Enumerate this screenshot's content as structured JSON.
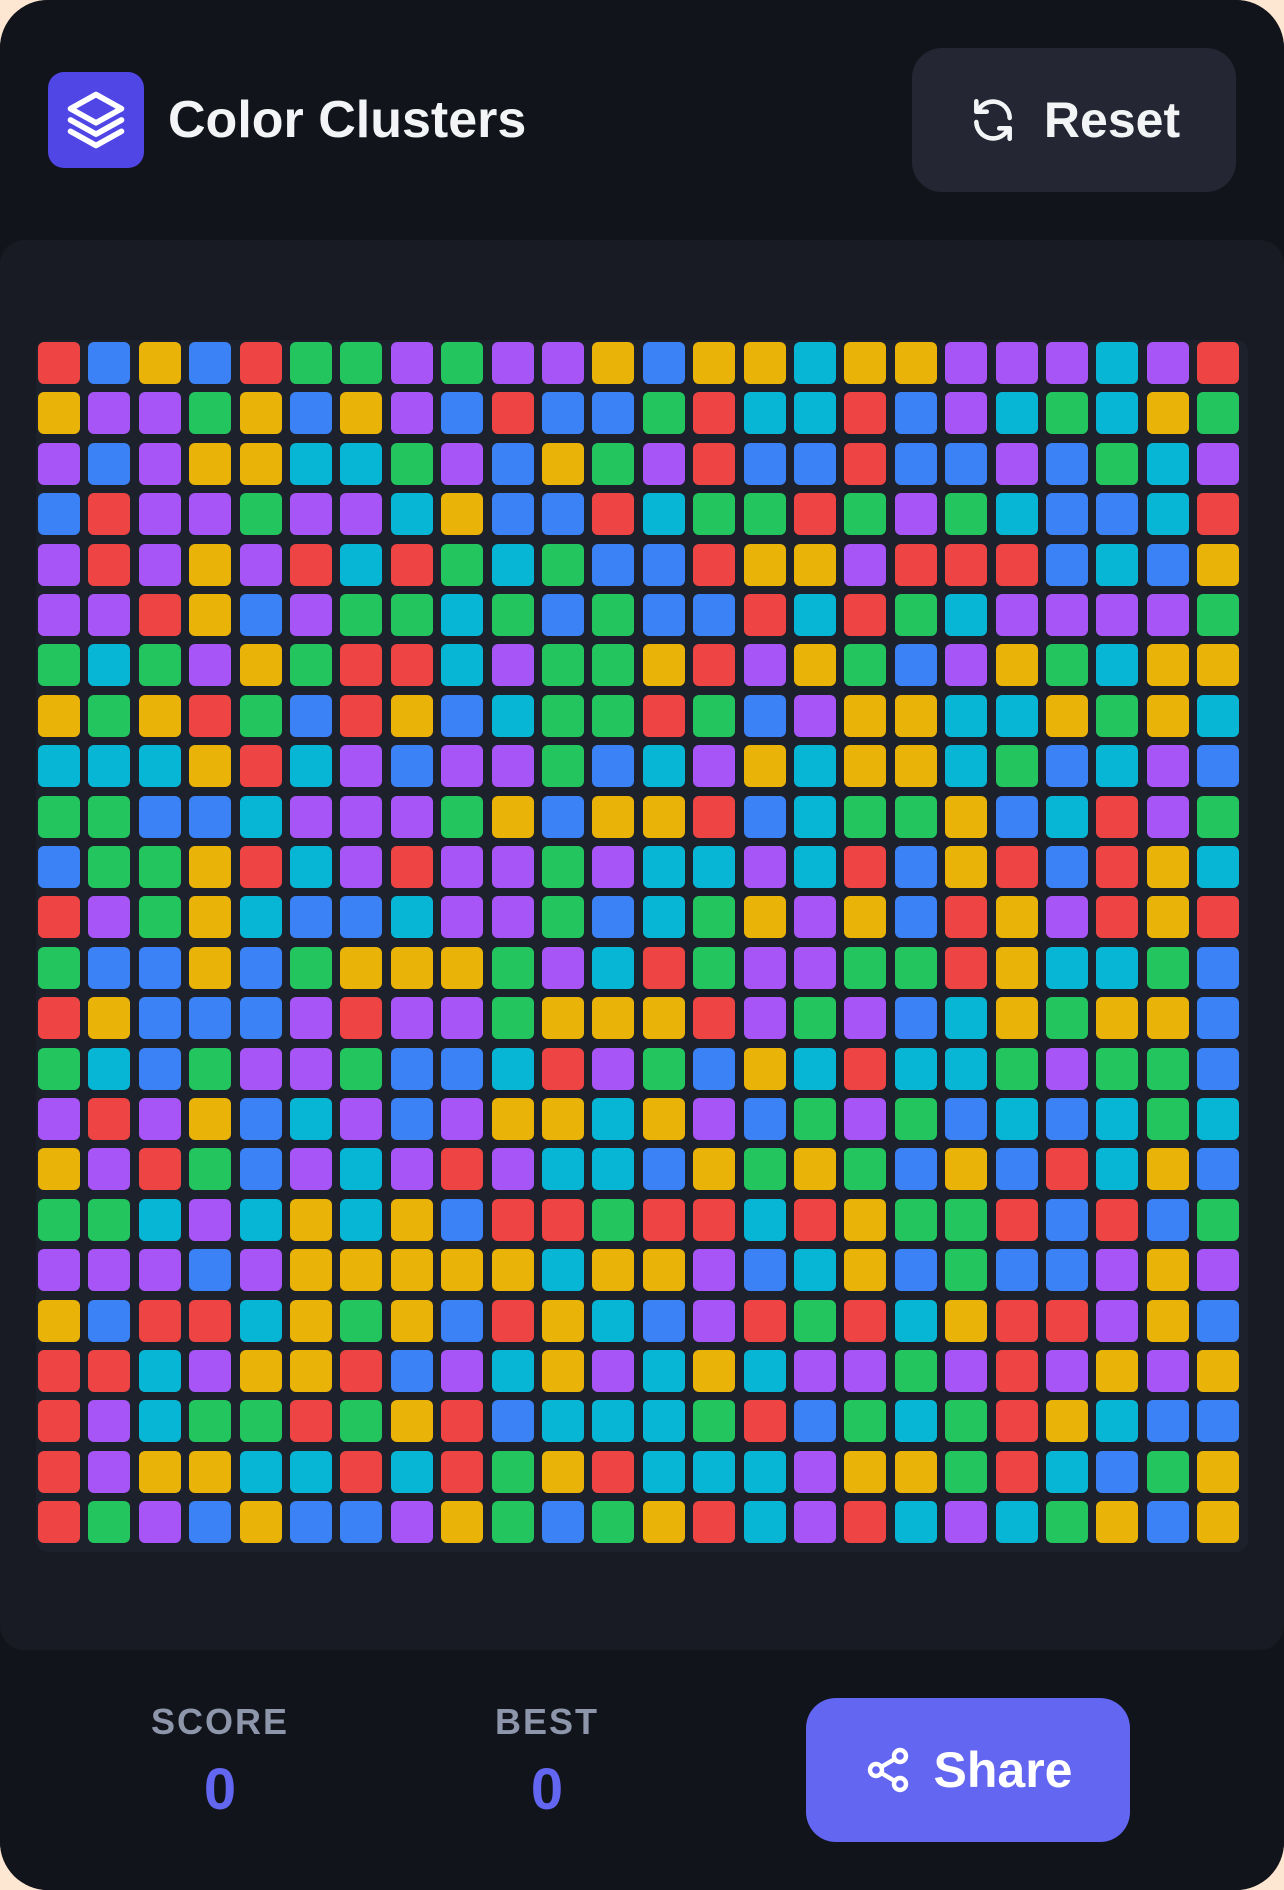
{
  "header": {
    "title": "Color Clusters",
    "logo_icon": "stacked-layers-icon",
    "reset_label": "Reset",
    "reset_icon": "refresh-icon"
  },
  "footer": {
    "score_label": "SCORE",
    "score_value": "0",
    "best_label": "BEST",
    "best_value": "0",
    "share_label": "Share",
    "share_icon": "share-icon"
  },
  "colors": {
    "R": "#ef4444",
    "B": "#3b82f6",
    "Y": "#eab308",
    "G": "#22c55e",
    "P": "#a855f7",
    "C": "#06b6d4",
    "accent": "#6366f1",
    "logo": "#4f46e5"
  },
  "grid": {
    "rows": 24,
    "cols": 24,
    "cells": [
      "RBYBRGGPGPPYBYYCYYPPPCPR",
      "YPPGYBYPBRBBGRCCRBPCGCYG",
      "PBPYYCCGPBYGPRBBRBBPBGCP",
      "BRPPGPPCYBBRCGGRGPGCBBCR",
      "PRPYPRCRGCGBBRYYPRRRBCBY",
      "PPRYBPGGCGBGBBRCRGCPPPPG",
      "GCGPYGRRCPGGYRPYGBPYGCYY",
      "YGYRGBRYBCGGRGBPYYCCYGYC",
      "CCCYRCPBPPGBCPYCYYCGBCPB",
      "GGBBCPPPGYBYYRBCGGYBCRPG",
      "BGGYRCPRPPGPCCPCRBYRBRYC",
      "RPGYCBBCPPGBCGYPYBRYPRYR",
      "GBBYBGYYYGPCRGPPGGRYCCGB",
      "RYBBBPRPPGYYYRPGPBCYGYYB",
      "GCBGPPGBBCRPGBYCRCCGPGGB",
      "PRPYBCPBPYYCYPBGPGBCBCGC",
      "YPRGBPCPRPCCBYGYGBYBRCYB",
      "GGCPCYCYBRRGRRCRYGGRBRBG",
      "PPPBPYYYYYCYYPBCYBGBBPYP",
      "YBRRCYGYBRYCBPRGRCYRRPYB",
      "RRCPYYRBPCYPCYCPPGPRPYPY",
      "RPCGGRGYRBCCCGRBGCGRYCBB",
      "RPYYCCRCRGYRCCCPYYGRCBGY",
      "RGPBYBBPYGBGYRCPRCPCGYBY"
    ]
  }
}
